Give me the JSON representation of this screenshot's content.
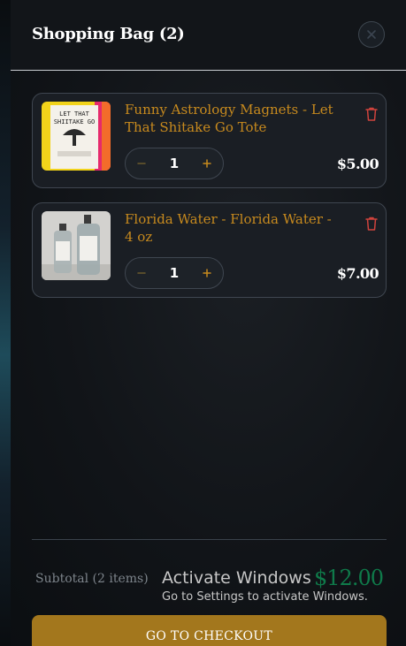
{
  "header": {
    "title": "Shopping Bag (2)"
  },
  "cart": {
    "items": [
      {
        "name": "Funny Astrology Magnets - Let That Shitake Go Tote",
        "quantity": "1",
        "price": "$5.00",
        "image": "tote-bag-product-image"
      },
      {
        "name": "Florida Water - Florida Water - 4 oz",
        "quantity": "1",
        "price": "$7.00",
        "image": "florida-water-bottles-image"
      }
    ]
  },
  "footer": {
    "subtotal_label": "Subtotal (2 items)",
    "subtotal_value": "$12.00",
    "checkout_label": "GO TO CHECKOUT"
  },
  "watermark": {
    "title": "Activate Windows",
    "subtitle": "Go to Settings to activate Windows."
  },
  "colors": {
    "accent": "#c78a1e",
    "checkout": "#a3771d",
    "subtotal": "#0f7a4a",
    "delete": "#d0433d"
  }
}
